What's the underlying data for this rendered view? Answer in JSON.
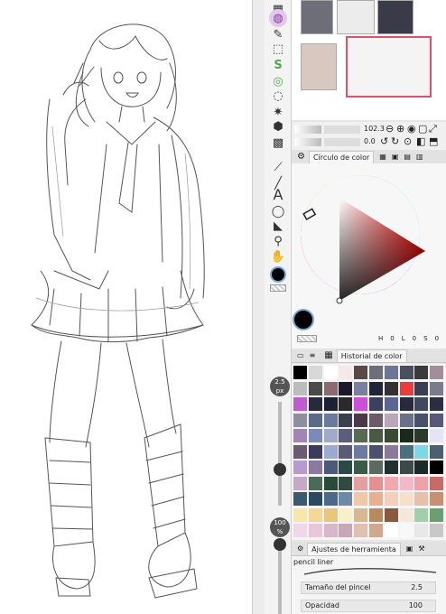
{
  "navigator": {
    "zoom_value": "102.3",
    "rotation_value": "0.0"
  },
  "color_panel": {
    "tab_label": "Círculo de color",
    "values_row": [
      "H",
      "0",
      "L",
      "0",
      "S",
      "0"
    ]
  },
  "history_panel": {
    "tab_label": "Historial de color"
  },
  "brush_size": {
    "value": "2.5",
    "unit": "px"
  },
  "opacity_level": {
    "value": "100",
    "unit": "%"
  },
  "tool_property": {
    "tab_label": "Ajustes de herramienta",
    "brush_name": "pencil liner",
    "size_label": "Tamaño del pincel",
    "size_value": "2.5",
    "opacity_label": "Opacidad",
    "opacity_value": "100"
  },
  "colors": {
    "current": "#000000",
    "wheel_marker": "#d24452",
    "triangle_hue": "#ff0000",
    "thumb_selected_border": "#e0506a"
  },
  "icons": {
    "tools": [
      "grid-icon",
      "pen-nib-icon",
      "selection-icon",
      "auto-select-icon",
      "s-curve-icon",
      "lasso-icon",
      "lasso-poly-icon",
      "magic-wand-icon",
      "cube-icon",
      "gradient-icon",
      "eyedropper-icon",
      "line-icon",
      "text-icon",
      "speech-bubble-icon",
      "triangle-fill-icon",
      "ink-drop-icon",
      "hand-icon",
      "color-swatch-icon"
    ]
  },
  "swatch_colors": [
    "#000000",
    "#d8d8d8",
    "#ffffff",
    "#f4e8e8",
    "#5b4949",
    "#6a6f7a",
    "#6d7693",
    "#4a4f5e",
    "#3a3a3a",
    "#a28e9a",
    "#bcbcbc",
    "#4a4a4a",
    "#8b6a72",
    "#1a1a2a",
    "#7b7fa0",
    "#20263a",
    "#323232",
    "#ea3b3d",
    "#3a3f55",
    "#7a7c8e",
    "#c05ad0",
    "#262a3a",
    "#1c2233",
    "#2a2a2a",
    "#cc4fd8",
    "#3a4060",
    "#5a6690",
    "#262a3a",
    "#40485d",
    "#2a2e40",
    "#8e8e9e",
    "#5a6a88",
    "#6a7a9a",
    "#3a4050",
    "#4a3a48",
    "#6a5a6a",
    "#b8a8b8",
    "#6a708a",
    "#48506a",
    "#565a78",
    "#a484b4",
    "#7a8abb",
    "#a0aacb",
    "#5c5c7c",
    "#5a6a52",
    "#4a5a40",
    "#3a4a30",
    "#1a2a1a",
    "#2a3a2a",
    "#e4e4f4",
    "#6a5a72",
    "#3b3b5b",
    "#9aaad0",
    "#5a5a7a",
    "#6a7aa0",
    "#4a5070",
    "#8a7a9a",
    "#4a7080",
    "#7ad8e8",
    "#4a6070",
    "#b89ad0",
    "#8a7aa0",
    "#4a5a7a",
    "#2a4a4a",
    "#3a5a4a",
    "#5a6a60",
    "#203030",
    "#3a4a4a",
    "#1a2a2a",
    "#000000",
    "#c8a8c8",
    "#4a6a5a",
    "#2a4a3a",
    "#304a40",
    "#e4a0a0",
    "#e49090",
    "#f0a8b0",
    "#f4b8c8",
    "#f0a0a8",
    "#c86a6a",
    "#3a5a70",
    "#2a4a60",
    "#4a6a8a",
    "#6a8aa8",
    "#f0c8a8",
    "#e8b090",
    "#f4d0b8",
    "#f8e0c8",
    "#e8c0a8",
    "#c89070",
    "#f8e8a8",
    "#f4d898",
    "#e8c878",
    "#f8f0c8",
    "#d8b890",
    "#b88a60",
    "#8a5a40",
    "#f4e8d8",
    "#a0d0a8",
    "#6aa070",
    "#f0d8e8",
    "#e8c8d8",
    "#d8b8c8",
    "#c8a8b8",
    "#e0c0b0",
    "#d0a890",
    "#ffffff",
    "#f8f8f8",
    "#e8e8e8",
    "#c8c8c8"
  ]
}
